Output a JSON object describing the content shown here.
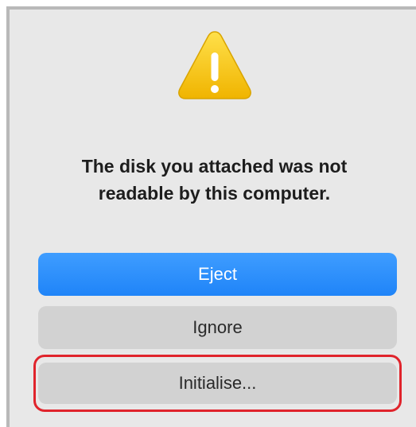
{
  "dialog": {
    "message": "The disk you attached was not\nreadable by this computer.",
    "icon": "warning-icon"
  },
  "buttons": {
    "eject_label": "Eject",
    "ignore_label": "Ignore",
    "initialise_label": "Initialise..."
  },
  "colors": {
    "primary_button": "#1f84f8",
    "secondary_button": "#d2d2d2",
    "highlight": "#e0242c",
    "warning_yellow": "#f5c400"
  }
}
